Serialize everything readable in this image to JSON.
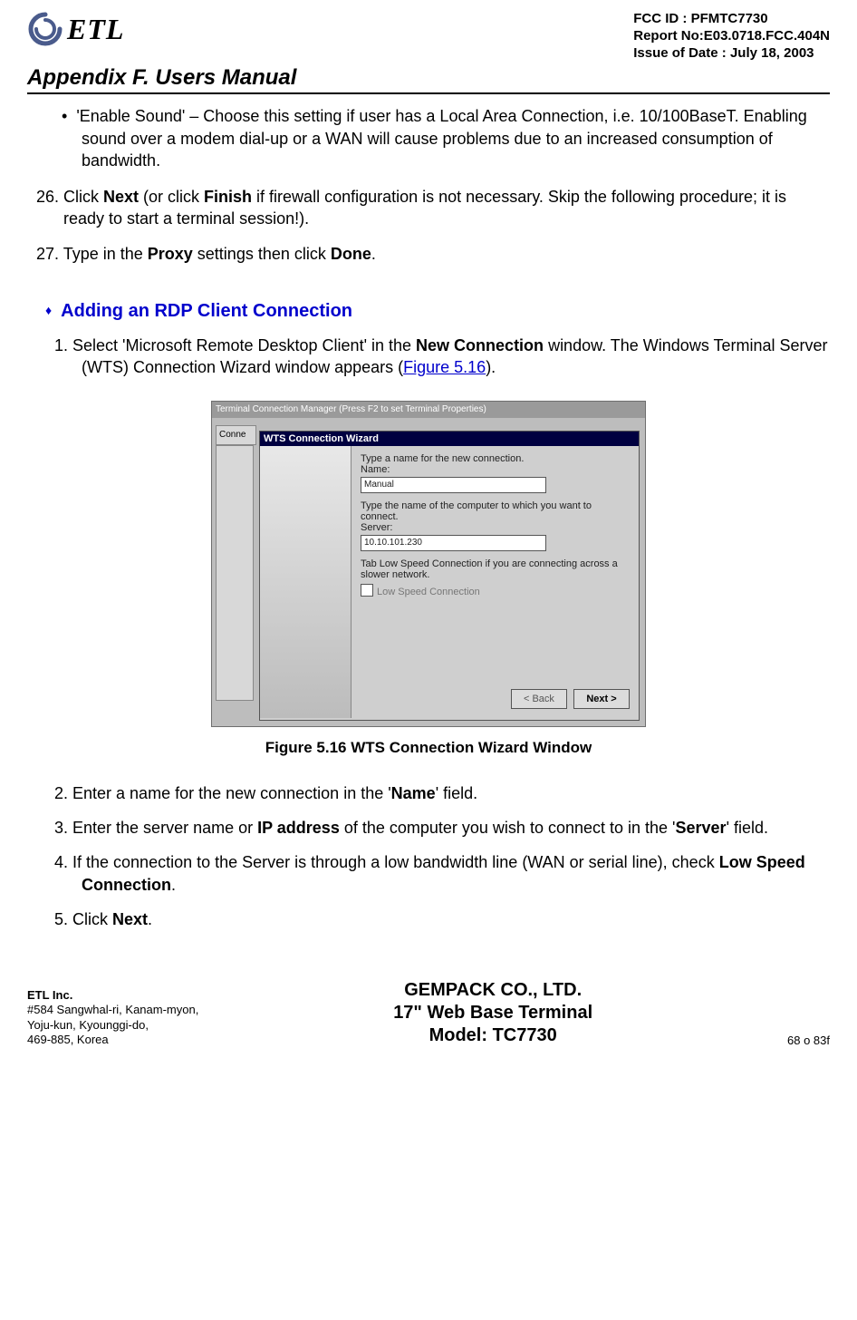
{
  "header": {
    "logo_text": "ETL",
    "fcc_id": "FCC ID : PFMTC7730",
    "report_no": "Report No:E03.0718.FCC.404N",
    "issue_date": "Issue of Date : July 18, 2003"
  },
  "appendix_title": "Appendix F.  Users Manual",
  "bullet_enable_sound": "'Enable Sound' – Choose this setting if user has a Local Area Connection, i.e. 10/100BaseT.  Enabling sound over a modem dial-up or a WAN will cause problems due to an increased consumption of bandwidth.",
  "step26_pre": "26. Click ",
  "step26_b1": "Next",
  "step26_mid": " (or click ",
  "step26_b2": "Finish",
  "step26_post": " if firewall configuration is not necessary.  Skip the following procedure; it is ready to start a terminal session!).",
  "step27_pre": "27. Type in the ",
  "step27_b1": "Proxy",
  "step27_mid": " settings then click ",
  "step27_b2": "Done",
  "step27_post": ".",
  "section_heading": "Adding an RDP Client Connection",
  "rdp1_pre": "1.  Select 'Microsoft Remote Desktop Client' in the ",
  "rdp1_b1": "New Connection",
  "rdp1_mid": " window.  The Windows Terminal Server (WTS) Connection Wizard window appears (",
  "rdp1_link": "Figure 5.16",
  "rdp1_post": ").",
  "wizard": {
    "outer_title": "Terminal Connection Manager (Press F2 to set Terminal Properties)",
    "left_tab": "Conne",
    "dlg_title": "WTS Connection Wizard",
    "line1": "Type a name for the new connection.",
    "label_name": "Name:",
    "name_value": "Manual",
    "line2": "Type the name of the computer to which you want to connect.",
    "label_server": "Server:",
    "server_value": "10.10.101.230",
    "line3": "Tab Low Speed Connection if you are connecting across a slower network.",
    "check_label": "Low Speed Connection",
    "btn_back": "< Back",
    "btn_next": "Next >"
  },
  "fig_caption": "Figure 5.16    WTS Connection Wizard Window",
  "rdp2_pre": "2.  Enter a name for the new connection in the '",
  "rdp2_b1": "Name",
  "rdp2_post": "' field.",
  "rdp3_pre": "3.  Enter the server name or ",
  "rdp3_b1": "IP address",
  "rdp3_mid": " of the computer you wish to connect to in the '",
  "rdp3_b2": "Server",
  "rdp3_post": "' field.",
  "rdp4_pre": "4.  If the connection to the Server is through a low bandwidth line (WAN or serial line), check ",
  "rdp4_b1": "Low Speed Connection",
  "rdp4_post": ".",
  "rdp5_pre": "5.  Click ",
  "rdp5_b1": "Next",
  "rdp5_post": ".",
  "footer": {
    "company": "ETL Inc.",
    "addr1": "#584 Sangwhal-ri, Kanam-myon,",
    "addr2": "Yoju-kun, Kyounggi-do,",
    "addr3": "469-885, Korea",
    "center1": "GEMPACK CO., LTD.",
    "center2": "17\" Web Base Terminal",
    "center3": "Model: TC7730",
    "page": "68 o 83f"
  }
}
